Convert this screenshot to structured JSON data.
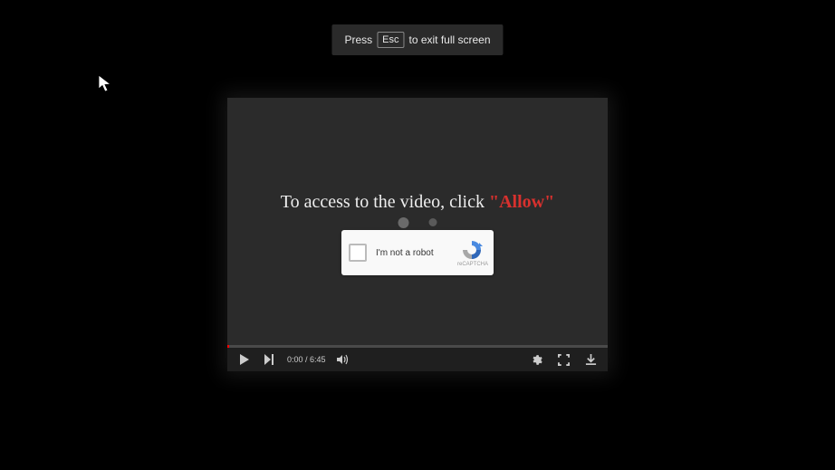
{
  "escNotice": {
    "before": "Press",
    "key": "Esc",
    "after": "to exit full screen"
  },
  "player": {
    "instructionPrefix": "To access to the video, click ",
    "instructionAllow": "\"Allow\"",
    "time": "0:00 / 6:45"
  },
  "captcha": {
    "label": "I'm not a robot",
    "brand": "reCAPTCHA"
  }
}
